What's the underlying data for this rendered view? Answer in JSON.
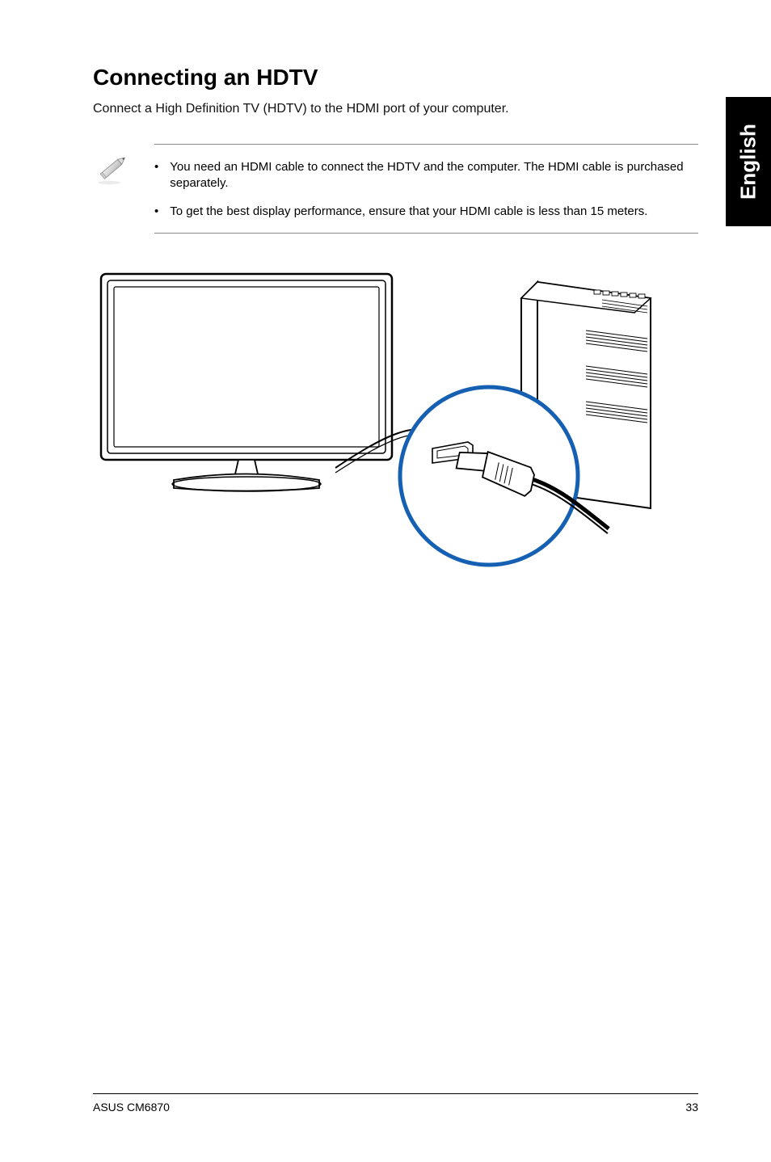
{
  "side_tab": "English",
  "heading": "Connecting an HDTV",
  "intro": "Connect a High Definition TV (HDTV) to the HDMI port of your computer.",
  "notes": {
    "items": [
      "You need an HDMI cable to connect the HDTV and the computer. The HDMI cable is purchased separately.",
      "To get the best display performance, ensure that your HDMI cable is less than 15 meters."
    ]
  },
  "footer": {
    "left": "ASUS CM6870",
    "right": "33"
  }
}
